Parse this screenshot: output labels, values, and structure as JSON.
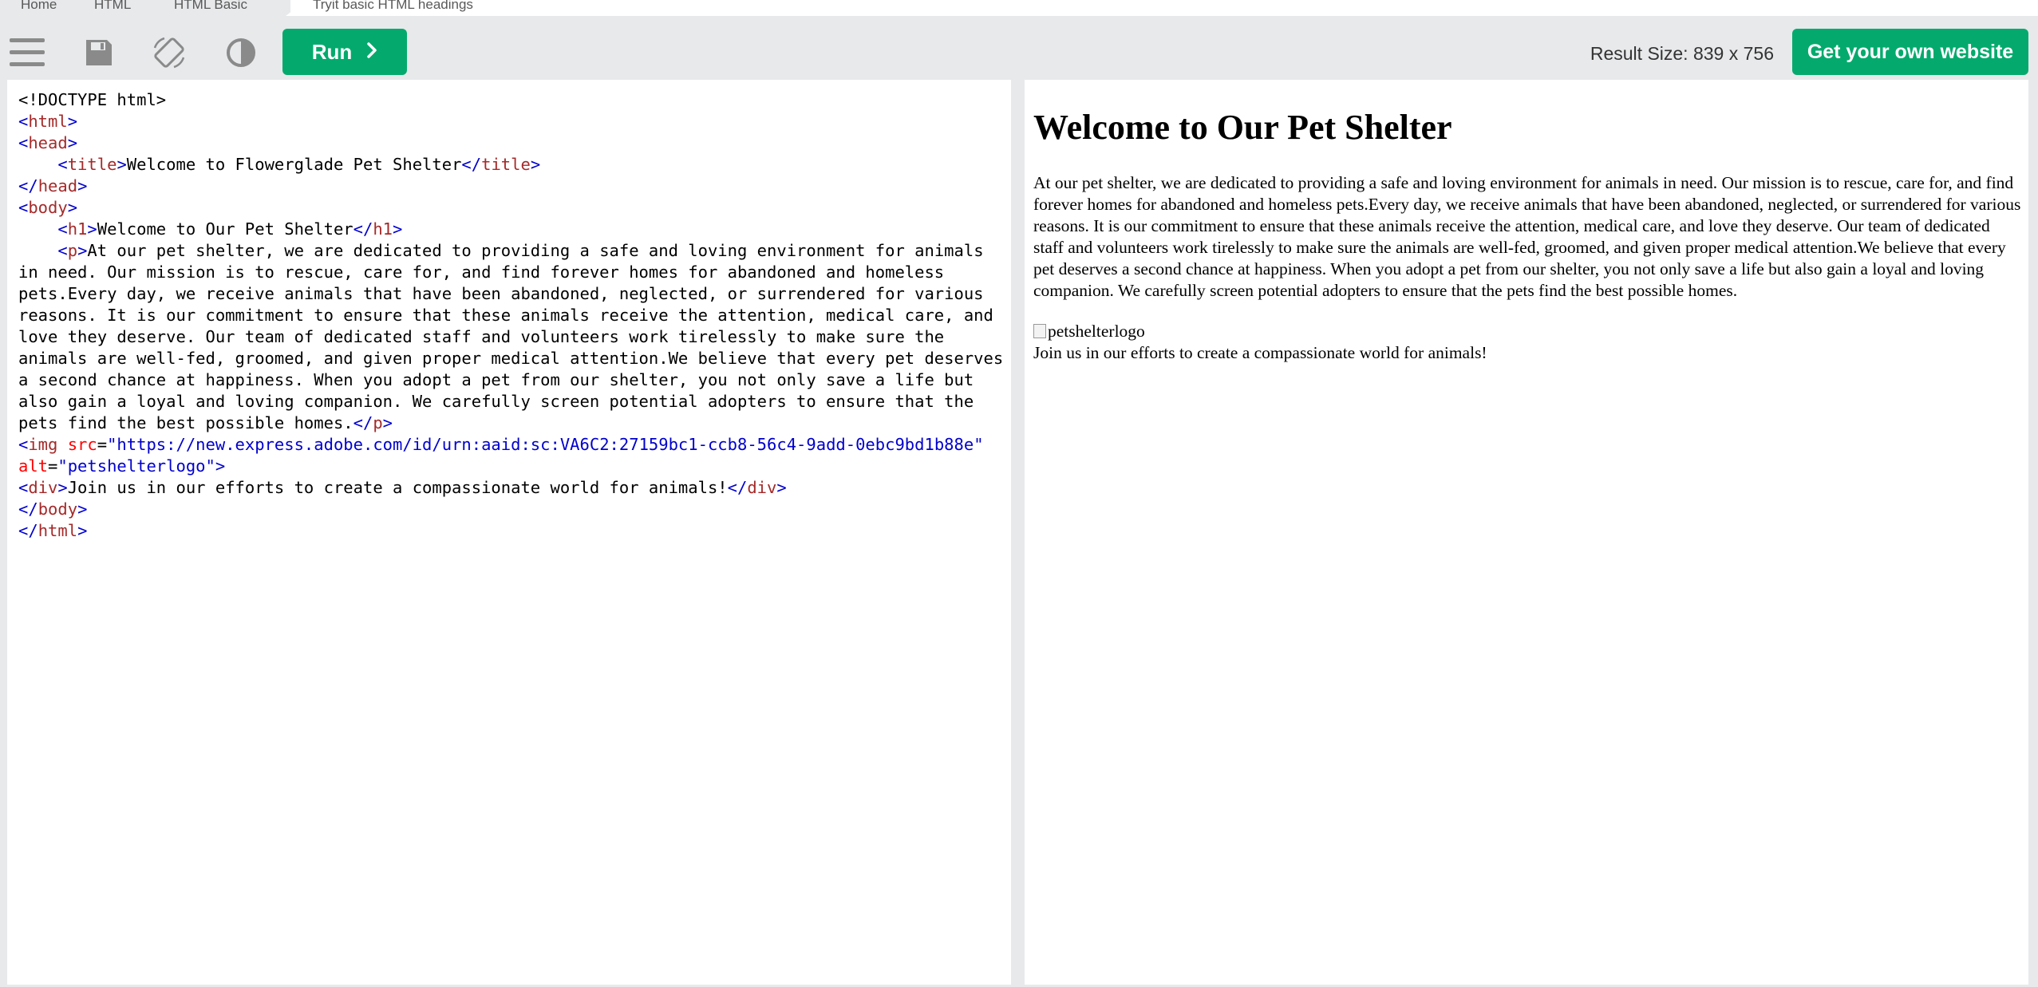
{
  "breadcrumb": [
    "Home",
    "HTML",
    "HTML Basic",
    "Tryit basic HTML headings"
  ],
  "toolbar": {
    "menu_icon": "hamburger-menu-icon",
    "save_icon": "save-icon",
    "rotate_icon": "rotate-icon",
    "theme_icon": "contrast-icon",
    "run_label": "Run",
    "result_size": "Result Size: 839 x 756",
    "get_website_label": "Get your own website"
  },
  "colors": {
    "accent": "#04aa6d",
    "tag": "#a52a2a",
    "bracket": "#0000cd",
    "attr": "#ff0000"
  },
  "code": {
    "doctype": "<!DOCTYPE html>",
    "title_text": "Welcome to Flowerglade Pet Shelter",
    "h1_text": "Welcome to Our Pet Shelter",
    "p_text": "At our pet shelter, we are dedicated to providing a safe and loving environment for animals in need. Our mission is to rescue, care for, and find forever homes for abandoned and homeless pets.Every day, we receive animals that have been abandoned, neglected, or surrendered for various reasons. It is our commitment to ensure that these animals receive the attention, medical care, and love they deserve. Our team of dedicated staff and volunteers work tirelessly to make sure the animals are well-fed, groomed, and given proper medical attention.We believe that every pet deserves a second chance at happiness. When you adopt a pet from our shelter, you not only save a life but also gain a loyal and loving companion. We carefully screen potential adopters to ensure that the pets find the best possible homes.",
    "img_src": "\"https://new.express.adobe.com/id/urn:aaid:sc:VA6C2:27159bc1-ccb8-56c4-9add-0ebc9bd1b88e\"",
    "img_alt": "\"petshelterlogo\"",
    "div_text": "Join us in our efforts to create a compassionate world for animals!"
  },
  "result": {
    "heading": "Welcome to Our Pet Shelter",
    "paragraph": "At our pet shelter, we are dedicated to providing a safe and loving environment for animals in need. Our mission is to rescue, care for, and find forever homes for abandoned and homeless pets.Every day, we receive animals that have been abandoned, neglected, or surrendered for various reasons. It is our commitment to ensure that these animals receive the attention, medical care, and love they deserve. Our team of dedicated staff and volunteers work tirelessly to make sure the animals are well-fed, groomed, and given proper medical attention.We believe that every pet deserves a second chance at happiness. When you adopt a pet from our shelter, you not only save a life but also gain a loyal and loving companion. We carefully screen potential adopters to ensure that the pets find the best possible homes.",
    "img_alt": "petshelterlogo",
    "join_text": "Join us in our efforts to create a compassionate world for animals!"
  }
}
